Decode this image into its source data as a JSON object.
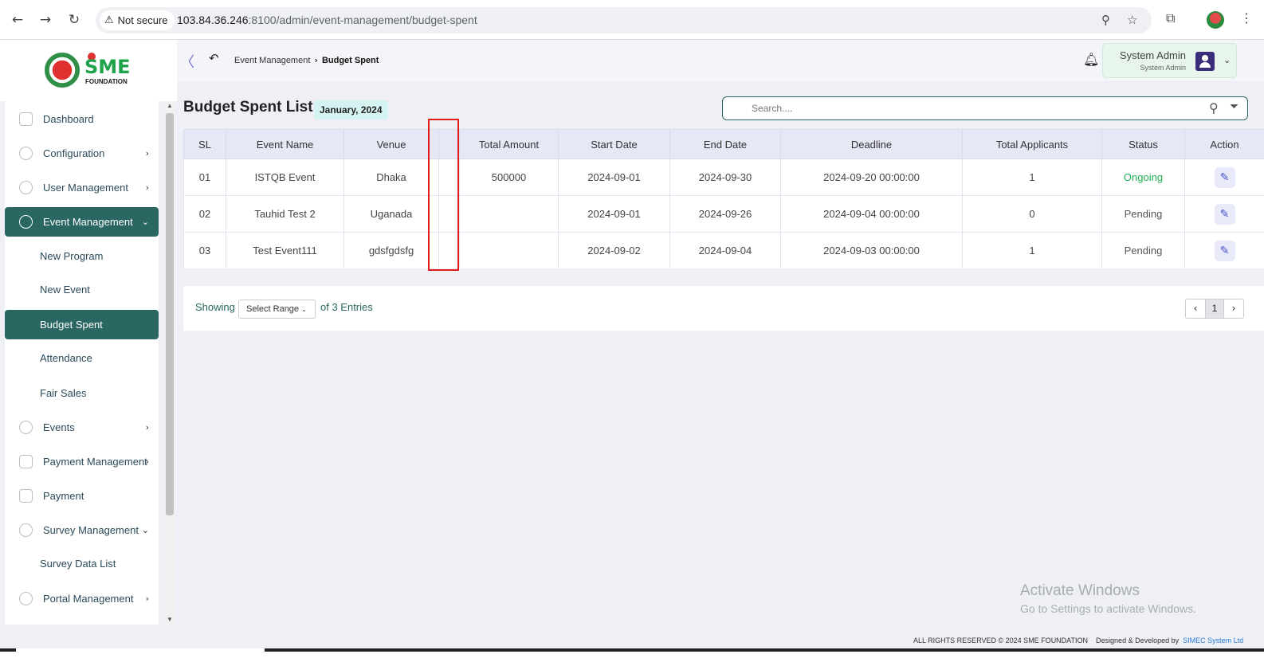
{
  "browser": {
    "security_label": "Not secure",
    "url_host": "103.84.36.246",
    "url_rest": ":8100/admin/event-management/budget-spent"
  },
  "brand": {
    "logo_text": "SME",
    "logo_subtext": "FOUNDATION"
  },
  "breadcrumb": {
    "parent": "Event Management",
    "current": "Budget Spent"
  },
  "user": {
    "name": "System Admin",
    "role": "System Admin"
  },
  "sidebar": {
    "items": [
      {
        "label": "Dashboard",
        "icon": "grid-icon"
      },
      {
        "label": "Configuration",
        "icon": "settings-icon",
        "arrow": "›"
      },
      {
        "label": "User Management",
        "icon": "shield-icon",
        "arrow": "›"
      },
      {
        "label": "Event Management",
        "icon": "lock-icon",
        "arrow": "⌄",
        "active": true
      },
      {
        "label": "New Program",
        "sub": true
      },
      {
        "label": "New Event",
        "sub": true
      },
      {
        "label": "Budget Spent",
        "sub": true,
        "active": true
      },
      {
        "label": "Attendance",
        "sub": true
      },
      {
        "label": "Fair Sales",
        "sub": true
      },
      {
        "label": "Events",
        "icon": "lock-icon",
        "arrow": "›"
      },
      {
        "label": "Payment Management",
        "icon": "money-icon",
        "arrow": "›"
      },
      {
        "label": "Payment",
        "icon": "money-icon"
      },
      {
        "label": "Survey Management",
        "icon": "pie-icon",
        "arrow": "⌄"
      },
      {
        "label": "Survey Data List",
        "sub": true
      },
      {
        "label": "Portal Management",
        "icon": "lock-icon",
        "arrow": "›"
      }
    ]
  },
  "main": {
    "title": "Budget Spent List",
    "date_badge": "January, 2024",
    "search_placeholder": "Search....",
    "table": {
      "headers": [
        "SL",
        "Event Name",
        "Venue",
        "",
        "Total Amount",
        "Start Date",
        "End Date",
        "Deadline",
        "Total Applicants",
        "Status",
        "Action"
      ],
      "rows": [
        [
          "01",
          "ISTQB Event",
          "Dhaka",
          "",
          "500000",
          "2024-09-01",
          "2024-09-30",
          "2024-09-20 00:00:00",
          "1",
          "Ongoing"
        ],
        [
          "02",
          "Tauhid Test 2",
          "Uganada",
          "",
          "",
          "2024-09-01",
          "2024-09-26",
          "2024-09-04 00:00:00",
          "0",
          "Pending"
        ],
        [
          "03",
          "Test Event111",
          "gdsfgdsfg",
          "",
          "",
          "2024-09-02",
          "2024-09-04",
          "2024-09-03 00:00:00",
          "1",
          "Pending"
        ]
      ]
    },
    "pagination": {
      "showing_label": "Showing",
      "range_select": "Select Range",
      "entries_label": "of 3 Entries",
      "current_page": "1"
    }
  },
  "watermark": {
    "line1": "Activate Windows",
    "line2": "Go to Settings to activate Windows."
  },
  "footer": {
    "rights": "ALL RIGHTS RESERVED © 2024 SME FOUNDATION",
    "dev_label": "Designed & Developed by",
    "dev_link": "SIMEC System Ltd"
  },
  "colors": {
    "brand_primary": "#2a6762",
    "status_ongoing": "#1fb153",
    "highlight": "#e11a1a"
  }
}
